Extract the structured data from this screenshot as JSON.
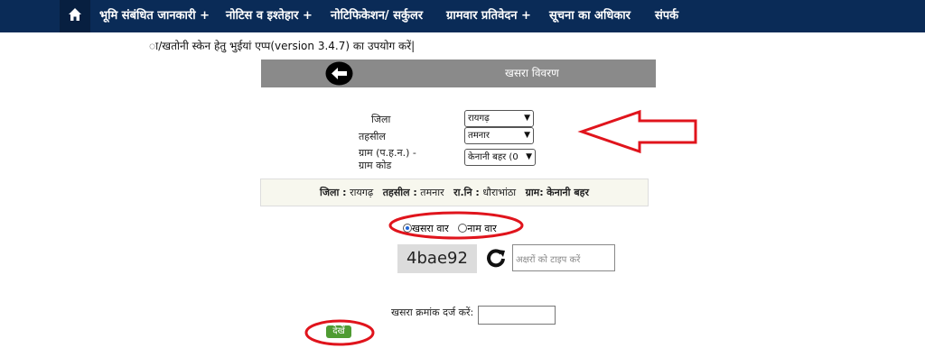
{
  "nav": {
    "home_icon": "home-icon",
    "items": [
      "भूमि संबंधित जानकारी +",
      "नोटिस व इश्तेहार +",
      "नोटिफिकेशन/ सर्कुलर",
      "ग्रामवार प्रतिवेदन +",
      "सूचना का अधिकार",
      "संपर्क"
    ]
  },
  "notice": "ा/खतोनी स्केन हेतु भुईयां एप्प(version 3.4.7) का उपयोग करें|",
  "header": {
    "title": "खसरा विवरण",
    "back_icon": "back-arrow-icon"
  },
  "form": {
    "district_label": "जिला",
    "district_value": "रायगढ़",
    "tehsil_label": "तहसील",
    "tehsil_value": "तमनार",
    "village_label_line1": "ग्राम (प.ह.न.) -",
    "village_label_line2": "ग्राम कोड",
    "village_value": "केनानी बहर (0"
  },
  "summary": {
    "district_label": "जिला :",
    "district_value": "रायगढ़",
    "tehsil_label": "तहसील :",
    "tehsil_value": "तमनार",
    "ri_label": "रा.नि :",
    "ri_value": "धौराभांठा",
    "village_label": "ग्राम:",
    "village_value": "केनानी बहर"
  },
  "search_mode": {
    "option1": "खसरा वार",
    "option2": "नाम वार",
    "selected": "option1"
  },
  "captcha": {
    "code": "4bae92",
    "placeholder": "अक्षरों को टाइप करें",
    "refresh_icon": "refresh-icon"
  },
  "khasra": {
    "label": "खसरा क्रमांक दर्ज करें:",
    "value": ""
  },
  "view_button": "देखें",
  "colors": {
    "nav": "#0a2b57",
    "header_bar": "#8a8a8a",
    "button": "#4f9b32",
    "annotation": "#e0141c"
  }
}
